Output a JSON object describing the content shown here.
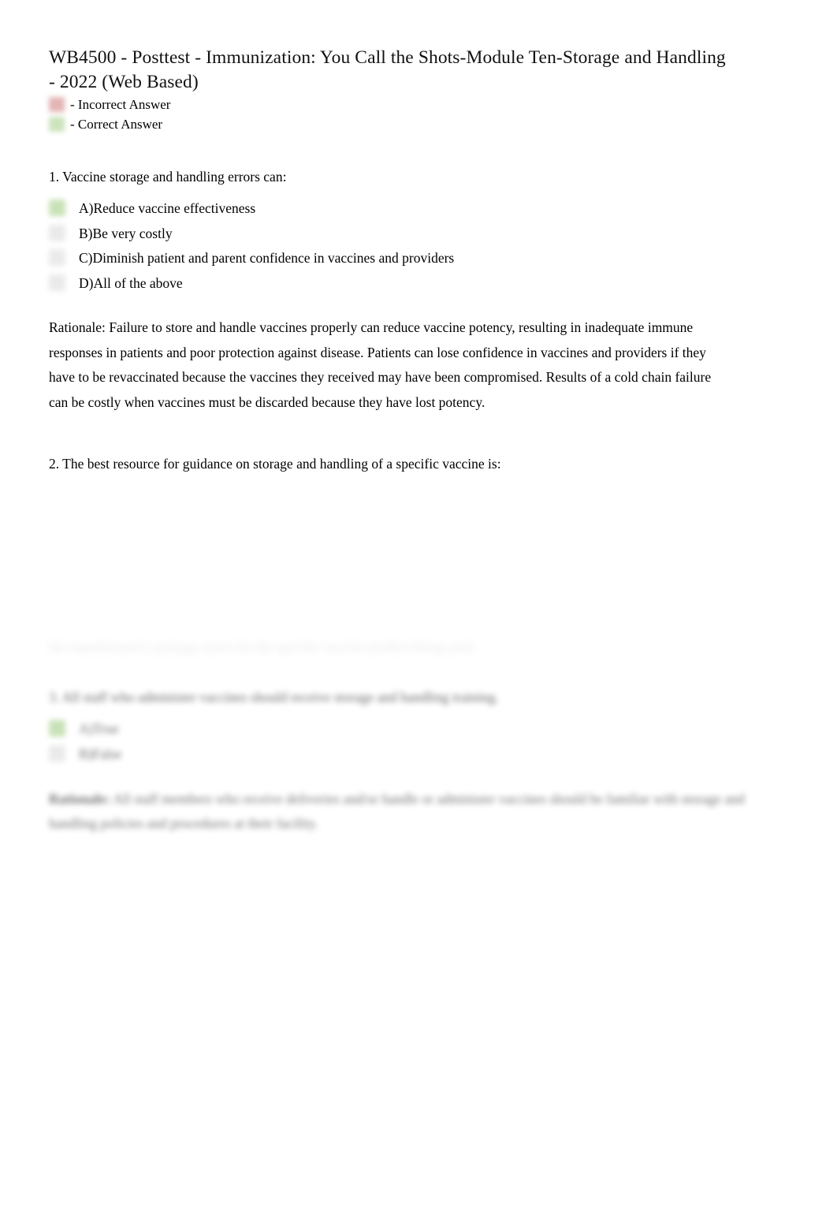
{
  "document": {
    "title": "WB4500 - Posttest - Immunization: You Call the Shots-Module Ten-Storage and Handling - 2022 (Web Based)"
  },
  "legend": {
    "incorrect": {
      "label": "- Incorrect Answer",
      "color": "#dfa8a8",
      "swatch_name": "incorrect-answer-swatch"
    },
    "correct": {
      "label": "- Correct Answer",
      "color": "#c3dfb0",
      "swatch_name": "correct-answer-swatch"
    }
  },
  "questions": [
    {
      "number": "1.",
      "stem": "1. Vaccine storage and handling errors can:",
      "options": [
        {
          "label": "A)Reduce vaccine effectiveness",
          "state": "correct"
        },
        {
          "label": "B)Be very costly",
          "state": "neutral"
        },
        {
          "label": "C)Diminish patient and parent confidence in vaccines and providers",
          "state": "neutral"
        },
        {
          "label": "D)All of the above",
          "state": "neutral"
        }
      ],
      "rationale_label": "Rationale:",
      "rationale_text": "  Failure to store and handle vaccines properly can reduce vaccine potency, resulting in inadequate immune responses in patients and poor protection against disease. Patients can lose confidence in vaccines and providers if they have to be revaccinated because the vaccines they received may have been compromised. Results of a cold chain failure can be costly when vaccines must be discarded because they have lost potency."
    },
    {
      "number": "2.",
      "stem": "2. The best resource for guidance on storage and handling of a specific vaccine is:"
    },
    {
      "number": "3.",
      "stem": "3. All staff who administer vaccines should receive storage and handling training.",
      "options": [
        {
          "label": "A)True",
          "state": "correct"
        },
        {
          "label": "B)False",
          "state": "neutral"
        }
      ],
      "rationale_label": "Rationale:",
      "rationale_text": " All staff members who receive deliveries and/or handle or administer vaccines should be familiar with storage and handling policies and procedures at their facility."
    }
  ],
  "ghost_line": {
    "text": "the manufacturer's package insert for the specific vaccine product being used"
  }
}
